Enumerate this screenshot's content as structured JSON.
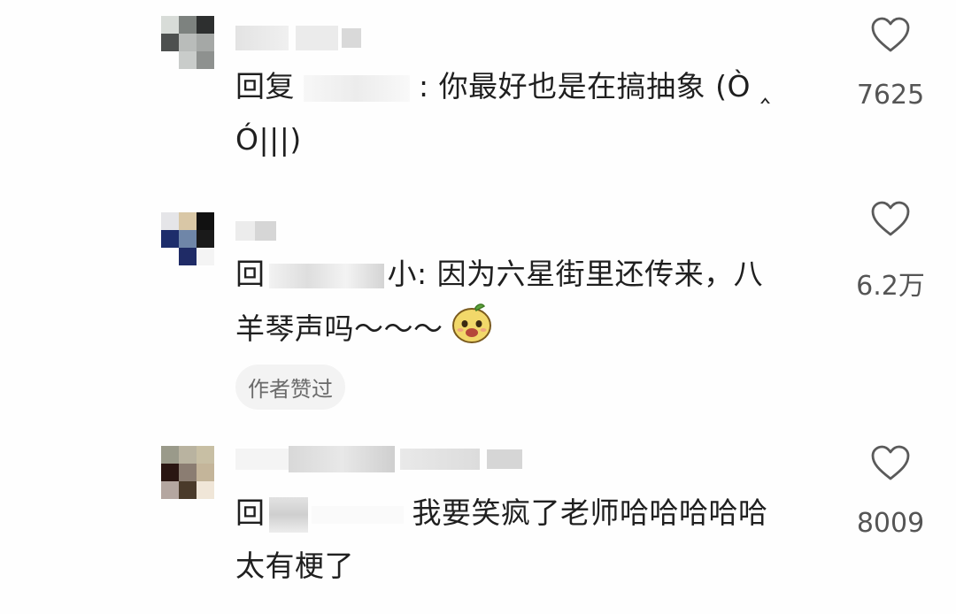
{
  "comments": [
    {
      "reply_prefix": "回复",
      "reply_text_line1": ": 你最好也是在搞抽象 (Ò ‸",
      "reply_text_line2": "Ó|||)",
      "like_count": "7625"
    },
    {
      "reply_prefix": "回",
      "reply_text_line1": "小: 因为六星街里还传来，八",
      "reply_text_line2": "羊琴声吗～～～",
      "like_count": "6.2万",
      "badge": "作者赞过"
    },
    {
      "reply_prefix": "回",
      "reply_text_line1": "我要笑疯了老师哈哈哈哈哈",
      "reply_text_line2": "太有梗了",
      "like_count": "8009"
    }
  ],
  "icons": {
    "like": "heart-outline-icon",
    "emoji": "smiling-face-emoji-icon"
  }
}
